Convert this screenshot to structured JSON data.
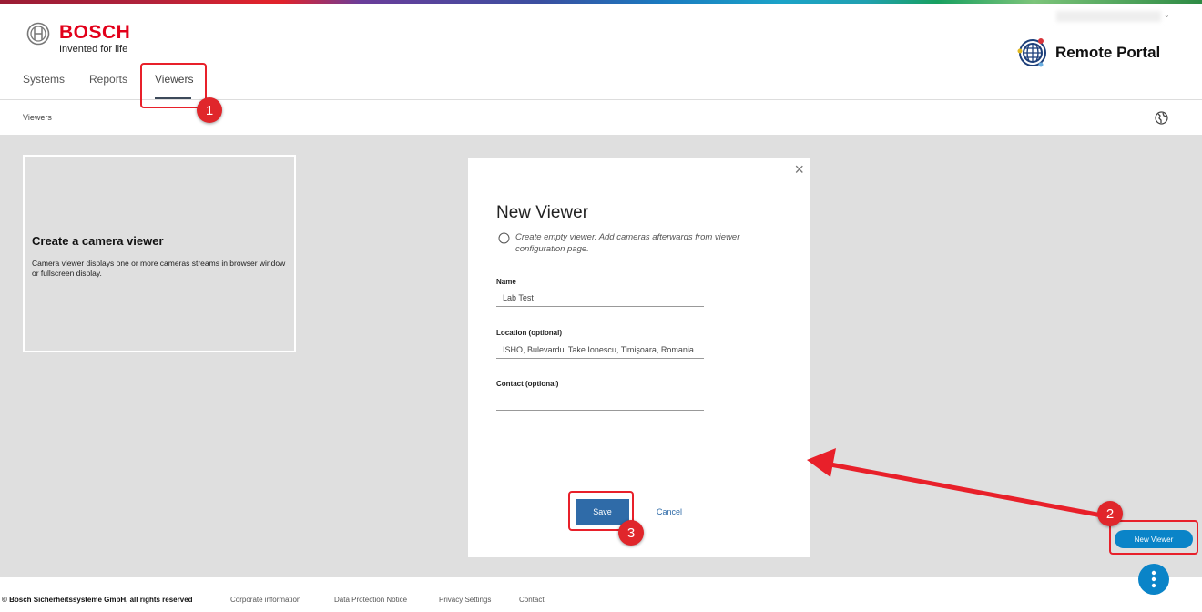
{
  "header": {
    "brand": "BOSCH",
    "tagline": "Invented for life",
    "app_title": "Remote Portal",
    "account": "",
    "tabs": [
      {
        "label": "Systems"
      },
      {
        "label": "Reports"
      },
      {
        "label": "Viewers",
        "active": true
      }
    ]
  },
  "breadcrumb": "Viewers",
  "card": {
    "title": "Create a camera viewer",
    "description": "Camera viewer displays one or more cameras streams in browser window or fullscreen display."
  },
  "modal": {
    "title": "New Viewer",
    "info": "Create empty viewer. Add cameras afterwards from viewer configuration page.",
    "fields": [
      {
        "label": "Name",
        "value": "Lab Test"
      },
      {
        "label": "Location (optional)",
        "value": "ISHO, Bulevardul Take Ionescu, Timişoara, Romania"
      },
      {
        "label": "Contact (optional)",
        "value": ""
      }
    ],
    "save": "Save",
    "cancel": "Cancel"
  },
  "new_viewer": "New Viewer",
  "annotations": [
    "1",
    "2",
    "3"
  ],
  "footer": {
    "copyright": "© Bosch Sicherheitssysteme GmbH, all rights reserved",
    "links": [
      "Corporate information",
      "Data Protection Notice",
      "Privacy Settings",
      "Contact"
    ]
  },
  "colors": {
    "brand_red": "#e2001a",
    "primary": "#2f6ba8",
    "accent": "#0a84c8",
    "annotation": "#e0262b"
  }
}
